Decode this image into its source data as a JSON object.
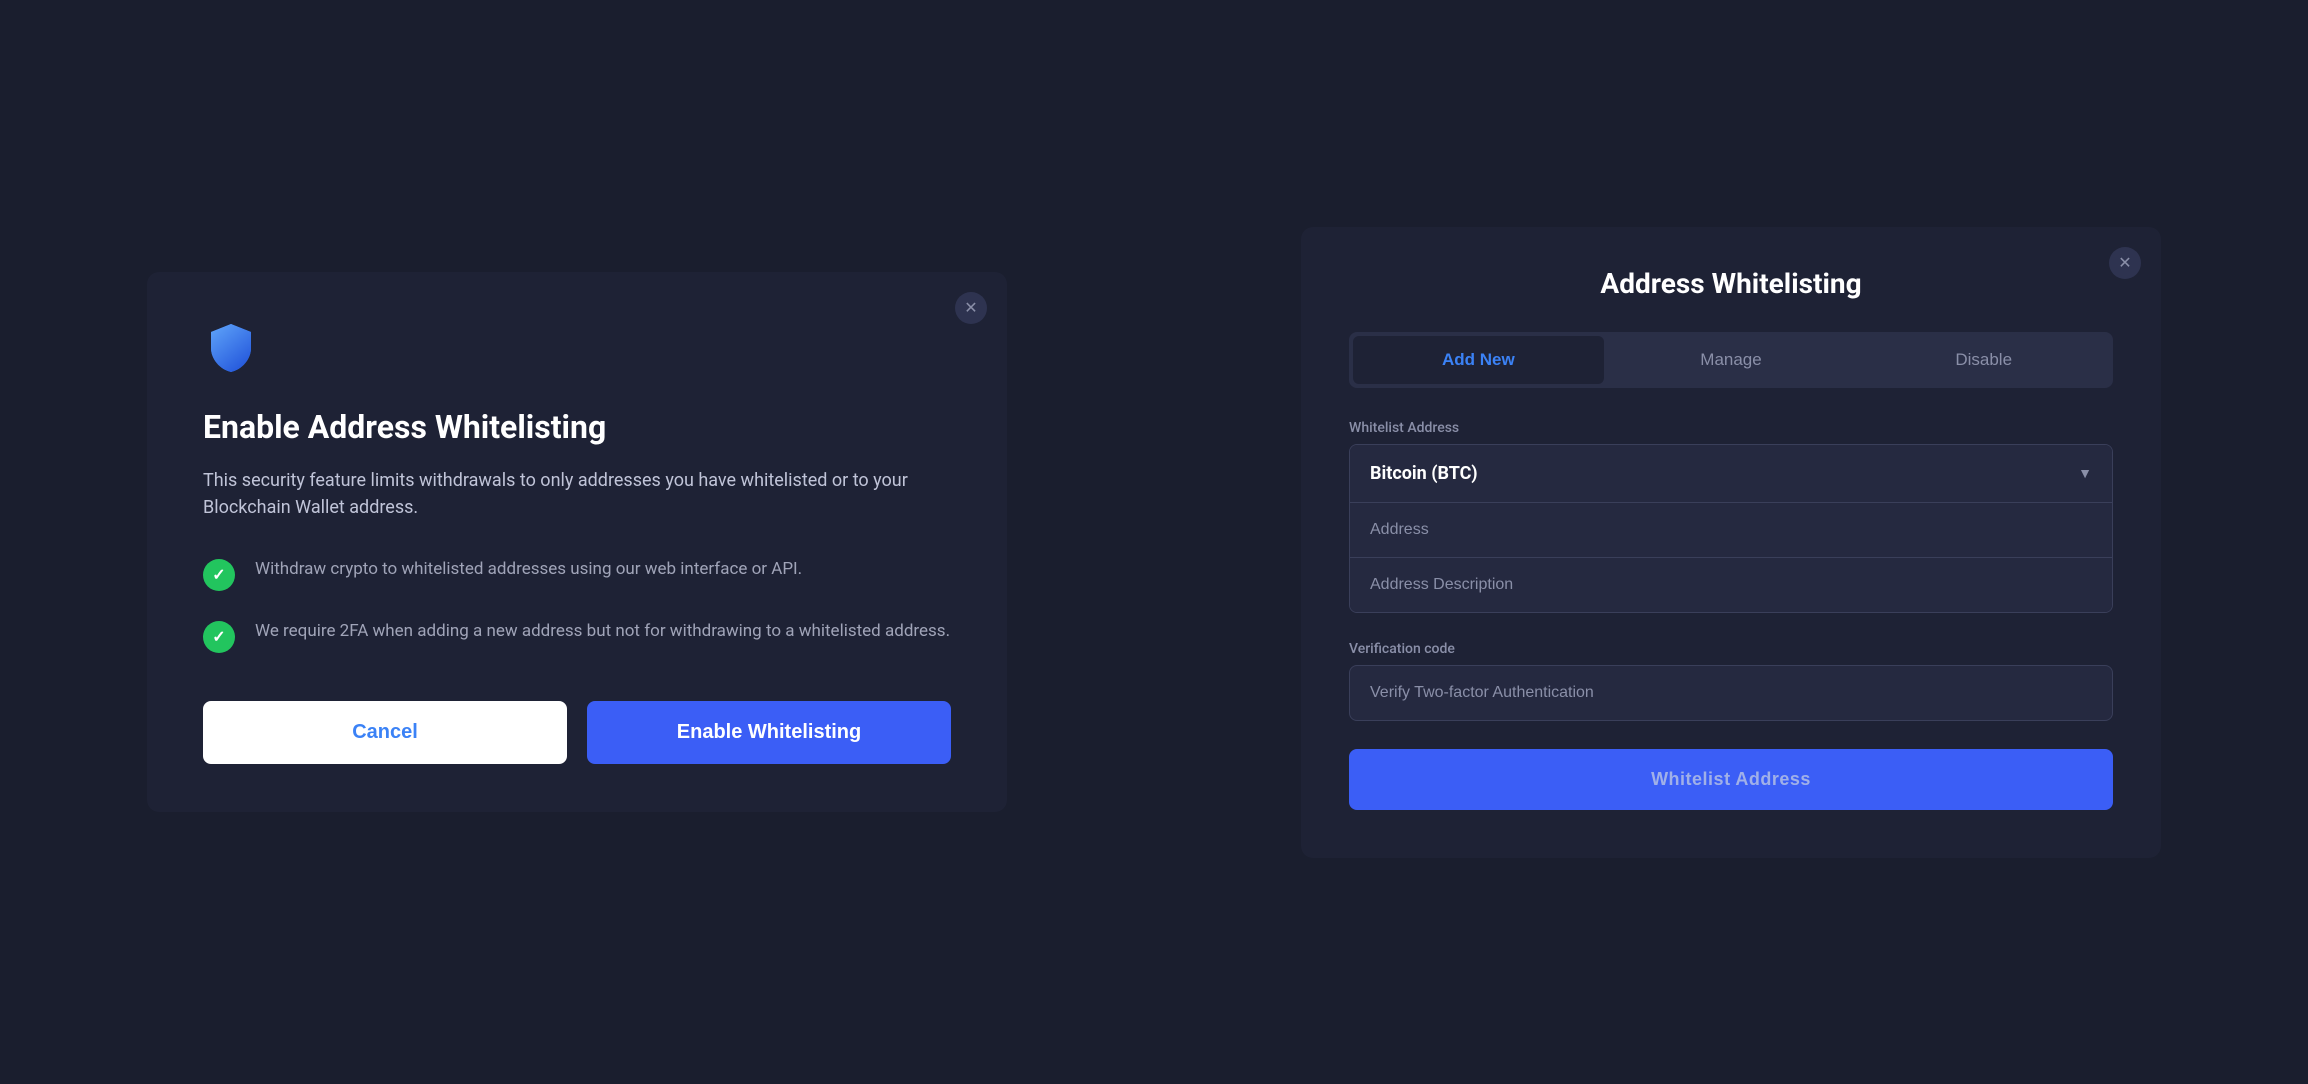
{
  "left_modal": {
    "close_label": "✕",
    "title": "Enable Address Whitelisting",
    "description": "This security feature limits withdrawals to only addresses you have whitelisted or to your Blockchain Wallet address.",
    "features": [
      {
        "text": "Withdraw crypto to whitelisted addresses using our web interface or API."
      },
      {
        "text": "We require 2FA when adding a new address but not for withdrawing to a whitelisted address."
      }
    ],
    "cancel_label": "Cancel",
    "enable_label": "Enable Whitelisting"
  },
  "right_modal": {
    "close_label": "✕",
    "title": "Address Whitelisting",
    "tabs": [
      {
        "label": "Add New",
        "active": true
      },
      {
        "label": "Manage",
        "active": false
      },
      {
        "label": "Disable",
        "active": false
      }
    ],
    "whitelist_address_label": "Whitelist Address",
    "dropdown_value": "Bitcoin (BTC)",
    "address_placeholder": "Address",
    "address_description_placeholder": "Address Description",
    "verification_label": "Verification code",
    "verification_placeholder": "Verify Two-factor Authentication",
    "submit_label": "Whitelist Address"
  },
  "icons": {
    "shield": "shield",
    "check": "check",
    "dropdown_arrow": "▼",
    "close": "✕"
  }
}
